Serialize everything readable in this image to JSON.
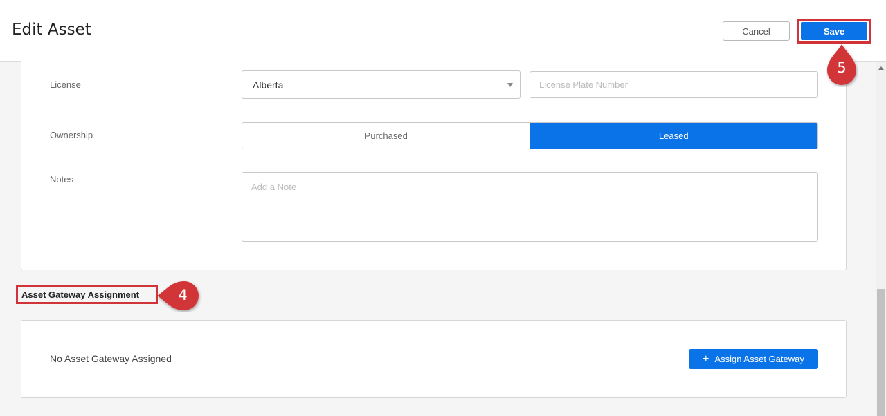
{
  "header": {
    "title": "Edit Asset",
    "cancel_label": "Cancel",
    "save_label": "Save"
  },
  "form": {
    "license": {
      "label": "License",
      "province": "Alberta",
      "plate_placeholder": "License Plate Number"
    },
    "ownership": {
      "label": "Ownership",
      "options": [
        "Purchased",
        "Leased"
      ],
      "selected": "Leased"
    },
    "notes": {
      "label": "Notes",
      "placeholder": "Add a Note"
    }
  },
  "gateway_section": {
    "title": "Asset Gateway Assignment",
    "empty_text": "No Asset Gateway Assigned",
    "assign_label": "Assign Asset Gateway"
  },
  "annotations": {
    "step_save": "5",
    "step_section": "4"
  },
  "colors": {
    "accent": "#0b73e8",
    "annotation": "#d13438"
  },
  "icons": {
    "select_caret": "chevron-down-icon",
    "assign_plus": "plus-icon"
  }
}
